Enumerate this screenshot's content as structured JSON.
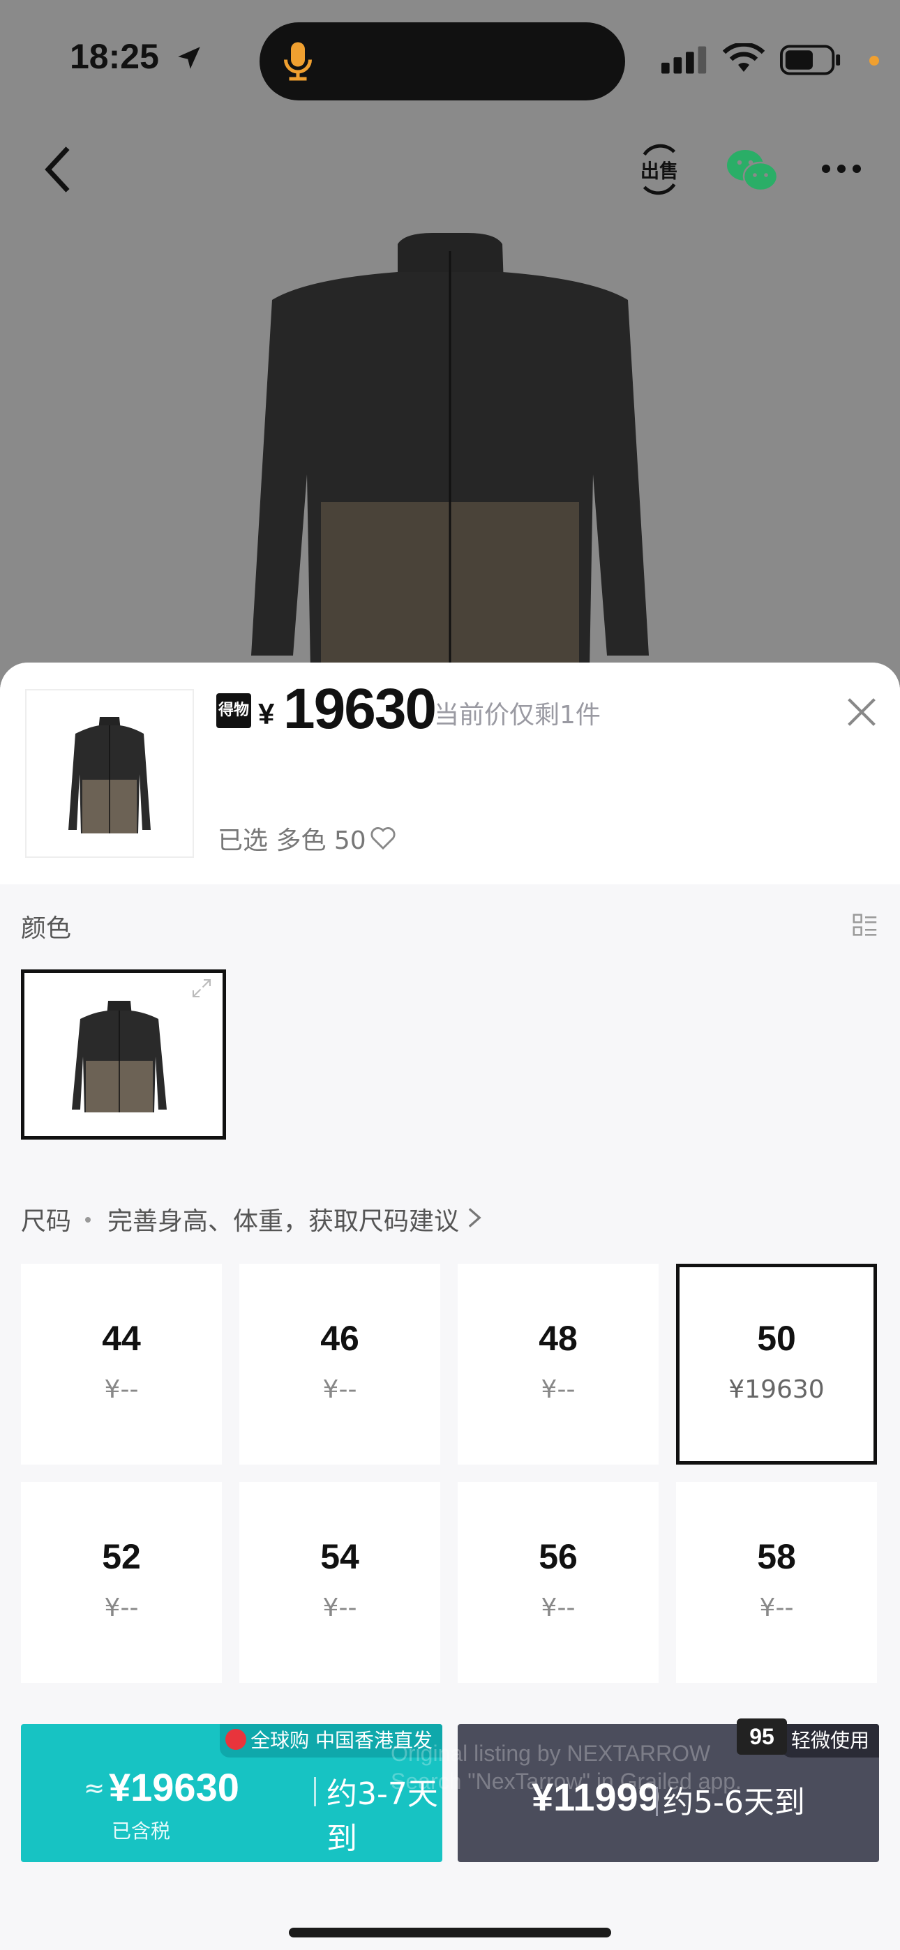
{
  "status_bar": {
    "time": "18:25"
  },
  "product": {
    "price_currency": "¥",
    "price": "19630",
    "price_note": "当前价仅剩1件",
    "selected_text": "已选  多色  50",
    "brand_logo_text": "得物"
  },
  "color_section": {
    "label": "颜色"
  },
  "size_section": {
    "label": "尺码",
    "tip": "完善身高、体重，获取尺码建议",
    "sizes": [
      {
        "size": "44",
        "price": "¥--"
      },
      {
        "size": "46",
        "price": "¥--"
      },
      {
        "size": "48",
        "price": "¥--"
      },
      {
        "size": "50",
        "price": "¥19630",
        "selected": true
      },
      {
        "size": "52",
        "price": "¥--"
      },
      {
        "size": "54",
        "price": "¥--"
      },
      {
        "size": "56",
        "price": "¥--"
      },
      {
        "size": "58",
        "price": "¥--"
      }
    ]
  },
  "buy_new": {
    "tag": "全球购 中国香港直发",
    "approx": "≈",
    "price": "¥19630",
    "delivery": "约3-7天到",
    "tax_note": "已含税",
    "color": "#17c3c3"
  },
  "buy_used": {
    "tag": "轻微使用",
    "condition_badge": "95",
    "price": "¥11999",
    "delivery": "约5-6天到",
    "color": "#4b4d5c"
  },
  "watermark": {
    "line1": "Original listing by NEXTARROW",
    "line2": "Search \"NexTarrow\" in Grailed app."
  }
}
